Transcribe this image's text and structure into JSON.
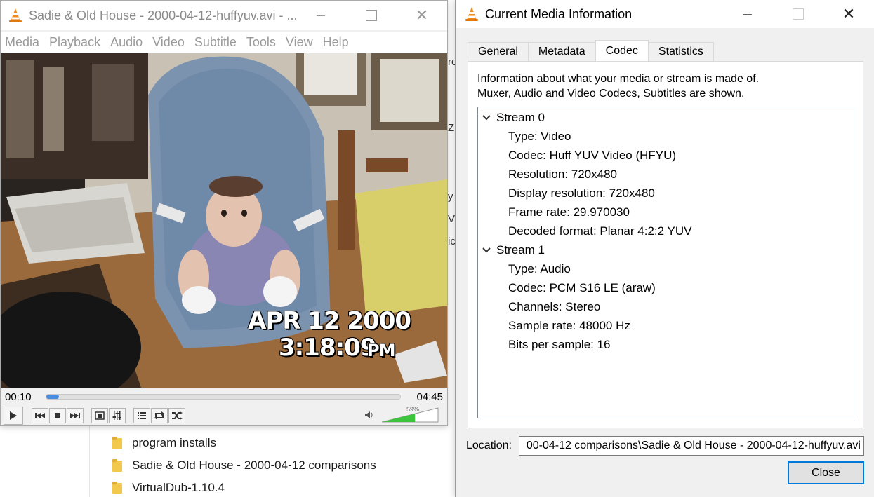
{
  "explorer": {
    "files": [
      {
        "name": "program installs"
      },
      {
        "name": "Sadie & Old House - 2000-04-12 comparisons"
      },
      {
        "name": "VirtualDub-1.10.4"
      }
    ],
    "peek_text": [
      "rc",
      "Z",
      "y",
      "V",
      "ic"
    ]
  },
  "player": {
    "title": "Sadie & Old House - 2000-04-12-huffyuv.avi - ...",
    "menu": [
      "Media",
      "Playback",
      "Audio",
      "Video",
      "Subtitle",
      "Tools",
      "View",
      "Help"
    ],
    "osd_date": "APR 12 2000",
    "osd_time": "3:18:09",
    "osd_ampm": "PM",
    "time_elapsed": "00:10",
    "time_total": "04:45",
    "seek_fraction": 0.035,
    "volume_percent": "59%",
    "volume_fraction": 0.59,
    "colors": {
      "accent": "#4a8ce0",
      "volume": "#3cc43c"
    }
  },
  "info": {
    "title": "Current Media Information",
    "tabs": [
      {
        "label": "General",
        "active": false
      },
      {
        "label": "Metadata",
        "active": false
      },
      {
        "label": "Codec",
        "active": true
      },
      {
        "label": "Statistics",
        "active": false
      }
    ],
    "description_line1": "Information about what your media or stream is made of.",
    "description_line2": "Muxer, Audio and Video Codecs, Subtitles are shown.",
    "streams": [
      {
        "label": "Stream 0",
        "fields": [
          "Type: Video",
          "Codec: Huff YUV Video (HFYU)",
          "Resolution: 720x480",
          "Display resolution: 720x480",
          "Frame rate: 29.970030",
          "Decoded format: Planar 4:2:2 YUV"
        ]
      },
      {
        "label": "Stream 1",
        "fields": [
          "Type: Audio",
          "Codec: PCM S16 LE (araw)",
          "Channels: Stereo",
          "Sample rate: 48000 Hz",
          "Bits per sample: 16"
        ]
      }
    ],
    "location_label": "Location:",
    "location_value": "00-04-12 comparisons\\Sadie & Old House - 2000-04-12-huffyuv.avi",
    "close_label": "Close"
  }
}
